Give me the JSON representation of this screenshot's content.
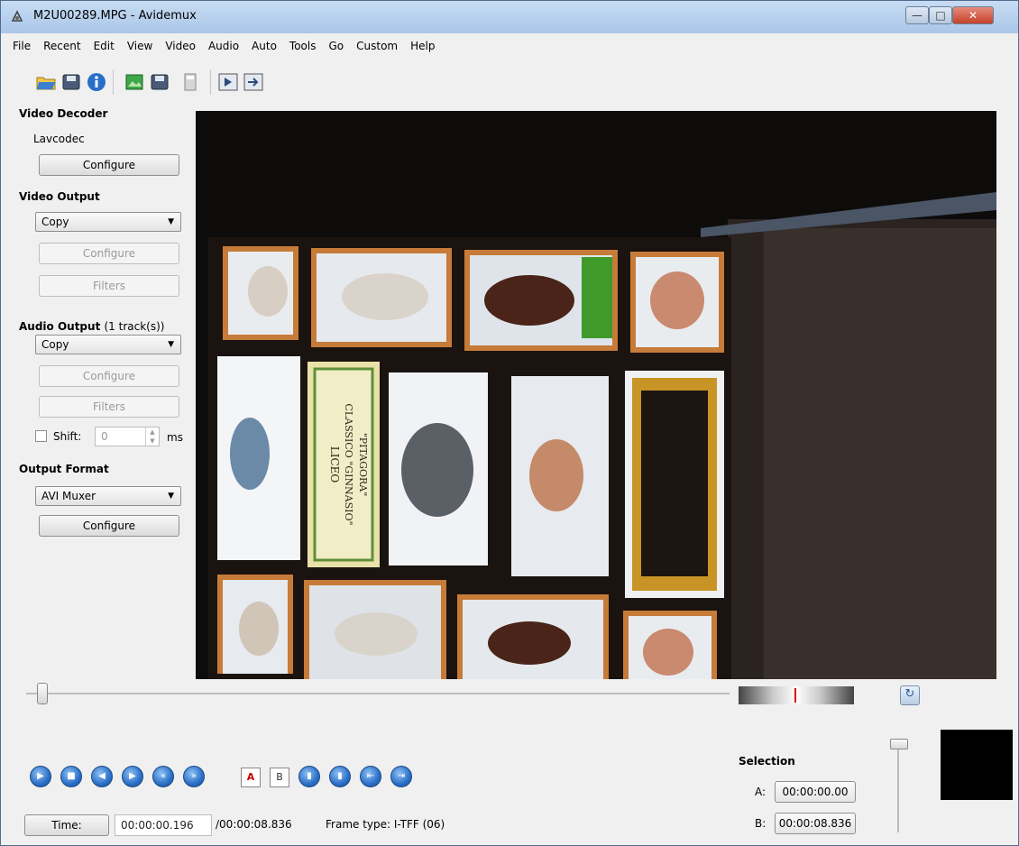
{
  "window": {
    "title": "M2U00289.MPG - Avidemux"
  },
  "menu": [
    "File",
    "Recent",
    "Edit",
    "View",
    "Video",
    "Audio",
    "Auto",
    "Tools",
    "Go",
    "Custom",
    "Help"
  ],
  "video_decoder": {
    "heading": "Video Decoder",
    "codec": "Lavcodec",
    "configure": "Configure"
  },
  "video_output": {
    "heading": "Video Output",
    "selected": "Copy",
    "configure": "Configure",
    "filters": "Filters"
  },
  "audio_output": {
    "heading": "Audio Output",
    "tracks": "(1 track(s))",
    "selected": "Copy",
    "configure": "Configure",
    "filters": "Filters",
    "shift_label": "Shift:",
    "shift_value": "0",
    "shift_unit": "ms"
  },
  "output_format": {
    "heading": "Output Format",
    "selected": "AVI Muxer",
    "configure": "Configure"
  },
  "selection": {
    "heading": "Selection",
    "a_label": "A:",
    "a_value": "00:00:00.00",
    "b_label": "B:",
    "b_value": "00:00:08.836"
  },
  "status": {
    "time_button": "Time:",
    "current_time": "00:00:00.196",
    "total_time": "/00:00:08.836",
    "frame_type": "Frame type:  I-TFF (06)"
  },
  "video_labels": {
    "tile_text_1": "LICEO",
    "tile_text_2": "CLASSICO \"GINNASIO\"",
    "tile_text_3": "\"PITAGORA\""
  },
  "colors": {
    "title_bar": "#b4cdea",
    "accent_blue": "#2a6fc7",
    "close_red": "#c5422b"
  }
}
